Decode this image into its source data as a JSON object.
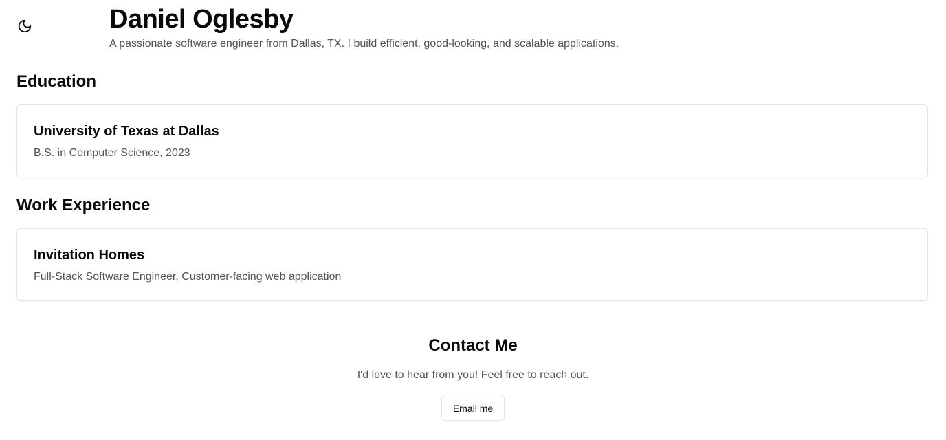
{
  "header": {
    "name": "Daniel Oglesby",
    "tagline": "A passionate software engineer from Dallas, TX. I build efficient, good-looking, and scalable applications."
  },
  "theme_toggle": {
    "icon": "moon-icon"
  },
  "education": {
    "title": "Education",
    "items": [
      {
        "school": "University of Texas at Dallas",
        "degree": "B.S. in Computer Science, 2023"
      }
    ]
  },
  "work": {
    "title": "Work Experience",
    "items": [
      {
        "company": "Invitation Homes",
        "role": "Full-Stack Software Engineer, Customer-facing web application"
      }
    ]
  },
  "contact": {
    "title": "Contact Me",
    "text": "I'd love to hear from you! Feel free to reach out.",
    "button_label": "Email me"
  },
  "colors": {
    "text": "#0a0a0a",
    "muted": "#52525b",
    "border": "#e4e4e7",
    "background": "#ffffff"
  }
}
